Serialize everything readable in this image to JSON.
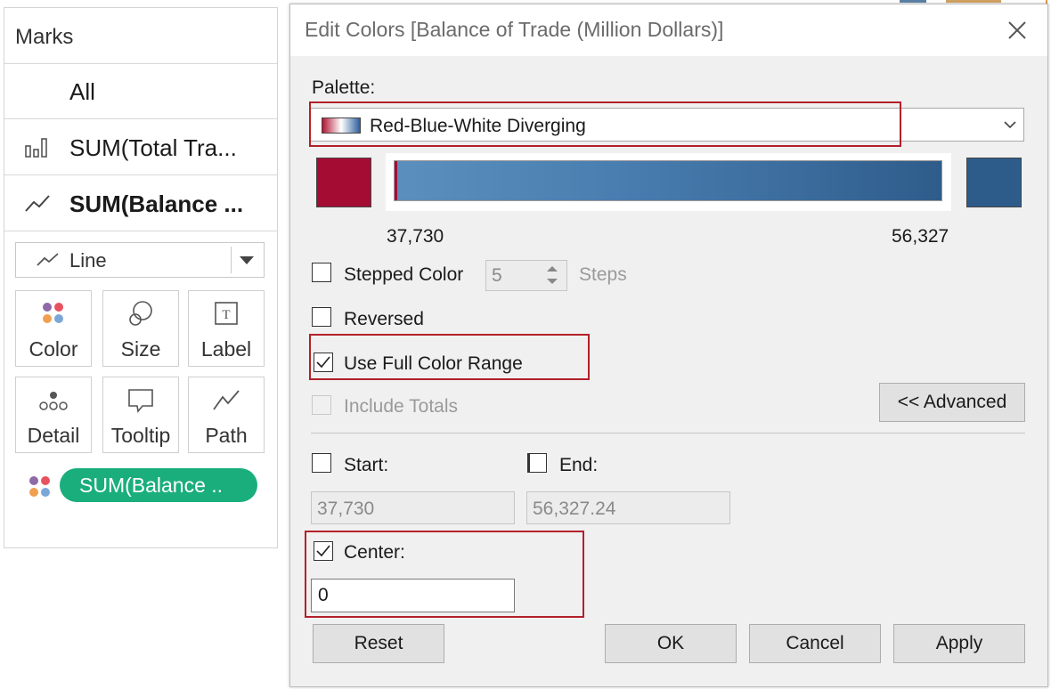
{
  "marks": {
    "title": "Marks",
    "rows": [
      {
        "label": "All"
      },
      {
        "label": "SUM(Total Tra...",
        "icon": "bar-chart-icon"
      },
      {
        "label": "SUM(Balance ...",
        "icon": "line-chart-icon"
      }
    ],
    "mark_type": "Line",
    "tiles": [
      {
        "label": "Color",
        "icon": "color-icon"
      },
      {
        "label": "Size",
        "icon": "size-icon"
      },
      {
        "label": "Label",
        "icon": "label-icon"
      },
      {
        "label": "Detail",
        "icon": "detail-icon"
      },
      {
        "label": "Tooltip",
        "icon": "tooltip-icon"
      },
      {
        "label": "Path",
        "icon": "path-icon"
      }
    ],
    "color_pill": "SUM(Balance .."
  },
  "dialog": {
    "title": "Edit Colors [Balance of Trade (Million Dollars)]",
    "palette_label": "Palette:",
    "palette_value": "Red-Blue-White Diverging",
    "range_min": "37,730",
    "range_max": "56,327",
    "colors": {
      "start": "#a50c34",
      "end": "#2e5c8a"
    },
    "stepped_color": {
      "label": "Stepped Color",
      "checked": false,
      "steps": "5",
      "steps_label": "Steps"
    },
    "reversed": {
      "label": "Reversed",
      "checked": false
    },
    "use_full_range": {
      "label": "Use Full Color Range",
      "checked": true
    },
    "include_totals": {
      "label": "Include Totals",
      "checked": false,
      "disabled": true
    },
    "advanced_button": "<< Advanced",
    "start": {
      "label": "Start:",
      "checked": false,
      "value": "37,730"
    },
    "end": {
      "label": "End:",
      "checked": false,
      "value": "56,327.24"
    },
    "center": {
      "label": "Center:",
      "checked": true,
      "value": "0"
    },
    "buttons": {
      "reset": "Reset",
      "ok": "OK",
      "cancel": "Cancel",
      "apply": "Apply"
    }
  }
}
